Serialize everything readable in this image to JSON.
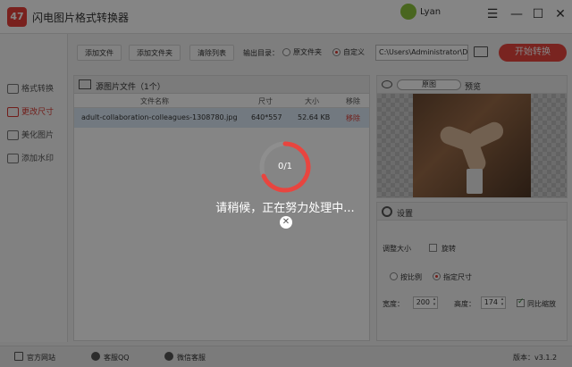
{
  "app": {
    "title": "闪电图片格式转换器",
    "logo_text": "47"
  },
  "user": {
    "name": "Lyan"
  },
  "window_controls": {
    "menu": "☰",
    "minimize": "—",
    "maximize": "☐",
    "close": "✕"
  },
  "sidebar": {
    "items": [
      {
        "label": "格式转换",
        "icon": "convert-icon"
      },
      {
        "label": "更改尺寸",
        "icon": "resize-icon",
        "active": true
      },
      {
        "label": "美化图片",
        "icon": "beautify-icon"
      },
      {
        "label": "添加水印",
        "icon": "watermark-icon"
      }
    ]
  },
  "toolbar": {
    "add_file": "添加文件",
    "add_folder": "添加文件夹",
    "clear_list": "清除列表",
    "output_dir_label": "输出目录：",
    "radio_original": "原文件夹",
    "radio_custom": "自定义",
    "path_value": "C:\\Users\\Administrator\\De",
    "start_button": "开始转换"
  },
  "file_list": {
    "title": "源图片文件（1个）",
    "columns": [
      "文件名称",
      "尺寸",
      "大小",
      "移除"
    ],
    "rows": [
      {
        "name": "adult-collaboration-colleagues-1308780.jpg",
        "dimension": "640*557",
        "size": "52.64 KB",
        "remove": "移除"
      }
    ]
  },
  "preview": {
    "mode": "原图",
    "label": "预览"
  },
  "settings": {
    "title": "设置",
    "resize_label": "调整大小",
    "rotate_label": "旋转",
    "by_ratio": "按比例",
    "by_size": "指定尺寸",
    "width_label": "宽度：",
    "width_value": "200",
    "height_label": "高度：",
    "height_value": "174",
    "keep_ratio": "同比缩放"
  },
  "footer": {
    "website": "官方网站",
    "qq": "客服QQ",
    "wechat": "微信客服",
    "version": "版本：v3.1.2"
  },
  "overlay": {
    "progress": "0/1",
    "message": "请稍候，正在努力处理中...",
    "close": "✕"
  },
  "colors": {
    "accent": "#e8453f",
    "active": "#d83a33",
    "overlay": "rgba(0,0,0,0.48)"
  }
}
